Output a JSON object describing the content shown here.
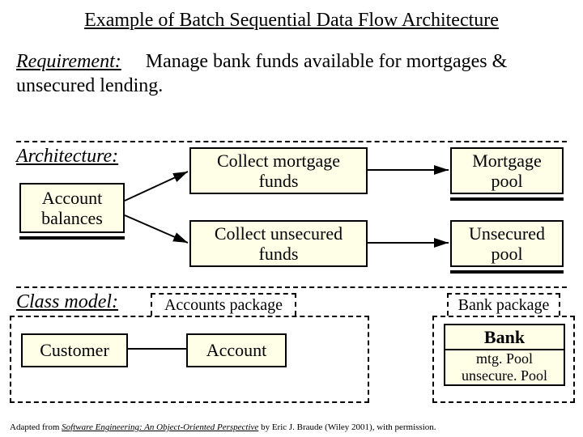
{
  "title": "Example of Batch Sequential Data Flow Architecture",
  "requirement": {
    "label": "Requirement:",
    "text": "Manage bank funds available for mortgages & unsecured lending."
  },
  "architecture": {
    "label": "Architecture:",
    "account_balances": "Account balances",
    "collect_mortgage": "Collect mortgage funds",
    "collect_unsecured": "Collect unsecured funds",
    "mortgage_pool": "Mortgage pool",
    "unsecured_pool": "Unsecured pool"
  },
  "class_model": {
    "label": "Class model:",
    "accounts_package": "Accounts package",
    "bank_package": "Bank package",
    "customer": "Customer",
    "account": "Account",
    "bank": "Bank",
    "mtg_pool": "mtg. Pool",
    "unsecure_pool": "unsecure. Pool"
  },
  "footnote": {
    "prefix": "Adapted from ",
    "book": "Software Engineering: An Object-Oriented Perspective",
    "suffix": " by Eric J. Braude (Wiley 2001), with permission."
  }
}
